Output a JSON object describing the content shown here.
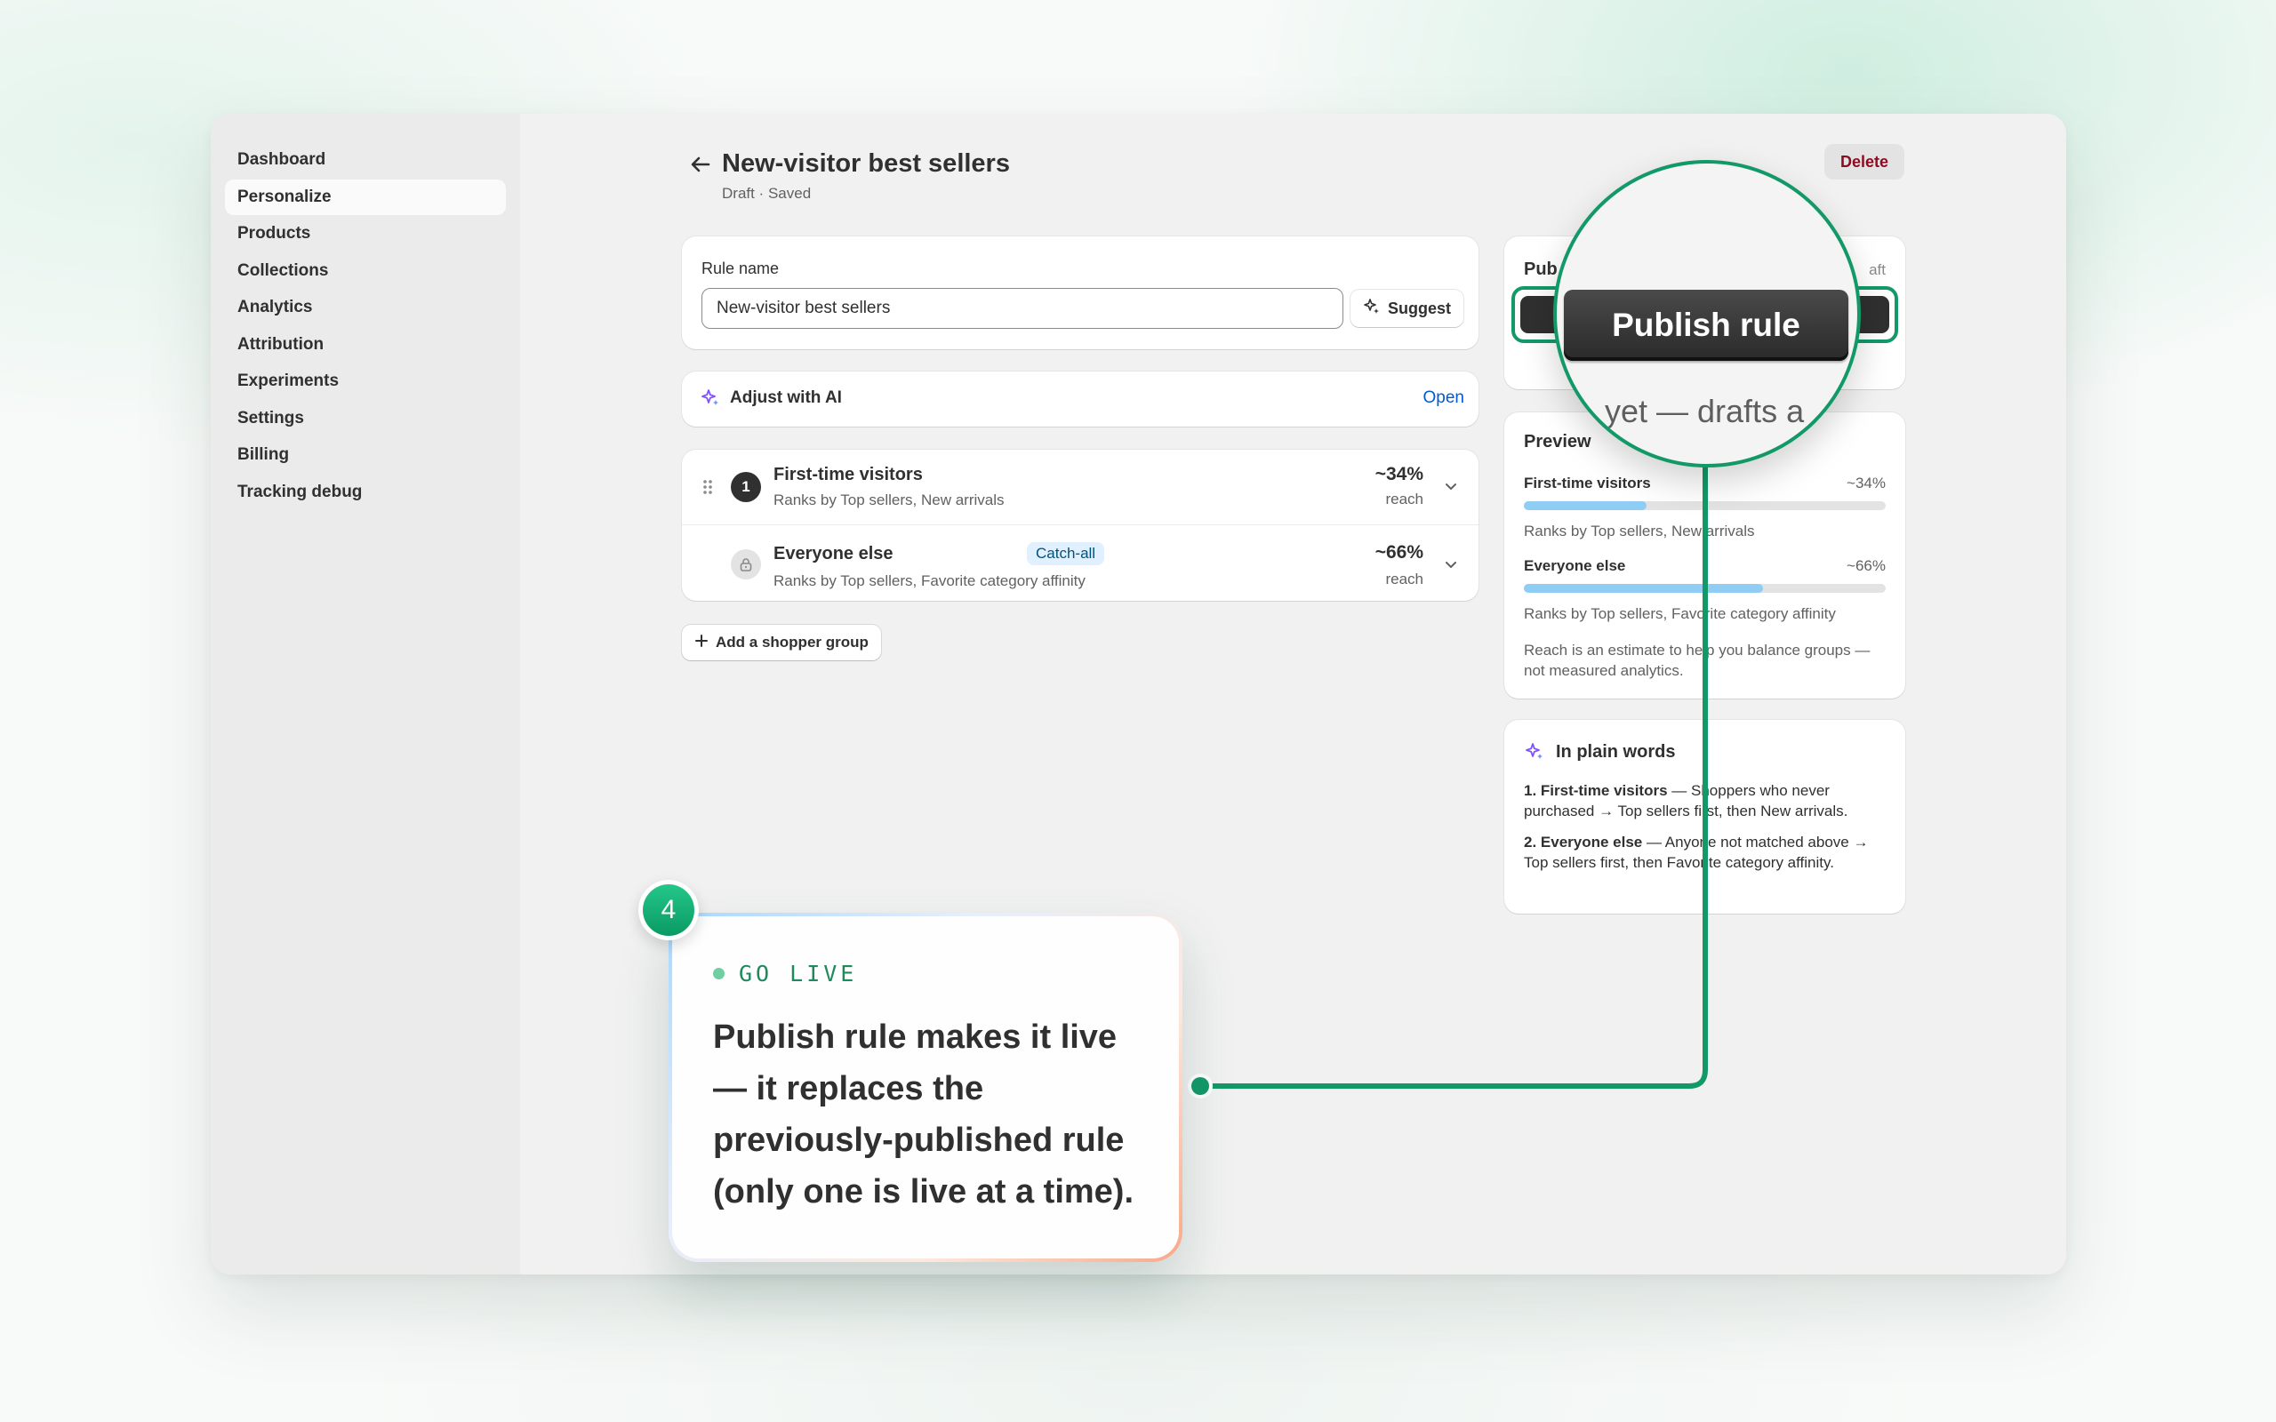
{
  "sidebar": {
    "items": [
      {
        "label": "Dashboard"
      },
      {
        "label": "Personalize"
      },
      {
        "label": "Products"
      },
      {
        "label": "Collections"
      },
      {
        "label": "Analytics"
      },
      {
        "label": "Attribution"
      },
      {
        "label": "Experiments"
      },
      {
        "label": "Settings"
      },
      {
        "label": "Billing"
      },
      {
        "label": "Tracking debug"
      }
    ],
    "active_index": 1
  },
  "header": {
    "title": "New-visitor best sellers",
    "status": "Draft · Saved",
    "delete_label": "Delete"
  },
  "rule_name": {
    "label": "Rule name",
    "value": "New-visitor best sellers",
    "suggest_label": "Suggest"
  },
  "adjust_ai": {
    "label": "Adjust with AI",
    "open_label": "Open"
  },
  "groups": [
    {
      "number": "1",
      "title": "First-time visitors",
      "subtitle": "Ranks by Top sellers, New arrivals",
      "percent": "~34%",
      "reach_label": "reach"
    },
    {
      "title": "Everyone else",
      "badge": "Catch-all",
      "subtitle": "Ranks by Top sellers, Favorite category affinity",
      "percent": "~66%",
      "reach_label": "reach"
    }
  ],
  "add_group_label": "Add a shopper group",
  "publish_card": {
    "title_partial": "Pub",
    "status_partial": "aft"
  },
  "preview": {
    "title": "Preview",
    "items": [
      {
        "name": "First-time visitors",
        "percent": "~34%",
        "fill": 0.34,
        "subtitle": "Ranks by Top sellers, New arrivals"
      },
      {
        "name": "Everyone else",
        "percent": "~66%",
        "fill": 0.66,
        "subtitle": "Ranks by Top sellers, Favorite category affinity"
      }
    ],
    "note": "Reach is an estimate to help you balance groups — not measured analytics."
  },
  "plain_words": {
    "title": "In plain words",
    "items": [
      {
        "bold": "1. First-time visitors",
        "text": " — Shoppers who never purchased → Top sellers first, then New arrivals."
      },
      {
        "bold": "2. Everyone else",
        "text": " — Anyone not matched above → Top sellers first, then Favorite category affinity."
      }
    ]
  },
  "magnifier": {
    "button_label": "Publish rule",
    "text": "yet — drafts a"
  },
  "callout": {
    "step": "4",
    "eyebrow": "GO LIVE",
    "text": "Publish rule makes it live — it replaces the previously-published rule (only one is live at a time)."
  },
  "colors": {
    "accent_green": "#139968",
    "link_blue": "#005bd3",
    "delete_red": "#8e0b21",
    "bar_blue": "#8fcdf4",
    "ai_purple": "#8051ff"
  }
}
